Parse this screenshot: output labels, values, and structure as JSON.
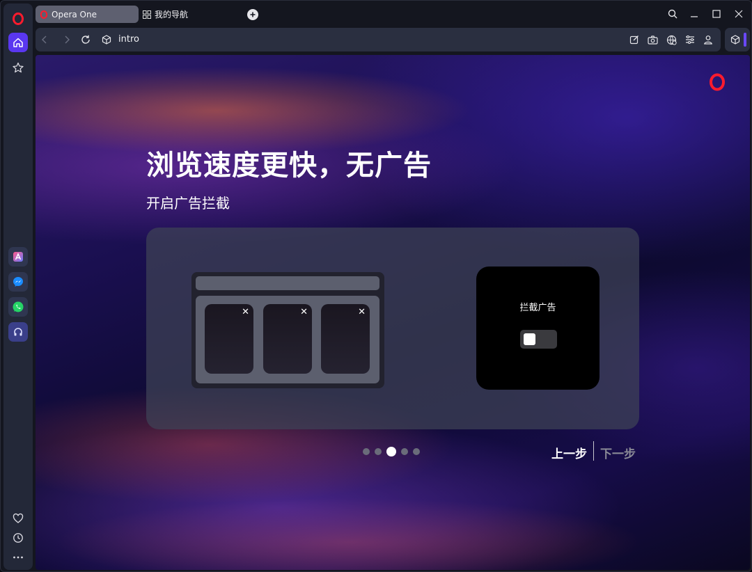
{
  "tabs": [
    {
      "label": "Opera One",
      "active": true
    },
    {
      "label": "我的导航",
      "active": false
    }
  ],
  "address_bar": {
    "url": "intro"
  },
  "page": {
    "headline": "浏览速度更快，无广告",
    "subline": "开启广告拦截",
    "toggle_label": "拦截广告",
    "toggle_on": false,
    "pager": {
      "total": 5,
      "current": 3
    },
    "prev_label": "上一步",
    "next_label": "下一步"
  },
  "colors": {
    "brand_red": "#ff1b2d",
    "accent_purple": "#5a37f0",
    "whatsapp_green": "#25d366",
    "messenger_blue": "#1a8cff"
  },
  "icons": {
    "sidebar": [
      "opera-logo-icon",
      "home-icon",
      "star-icon",
      "aria-icon",
      "messenger-icon",
      "whatsapp-icon",
      "music-player-icon",
      "heart-icon",
      "history-icon",
      "more-icon"
    ],
    "toolbar": [
      "edit-icon",
      "camera-icon",
      "vpn-icon",
      "easy-setup-icon",
      "profile-icon",
      "extensions-icon"
    ]
  }
}
